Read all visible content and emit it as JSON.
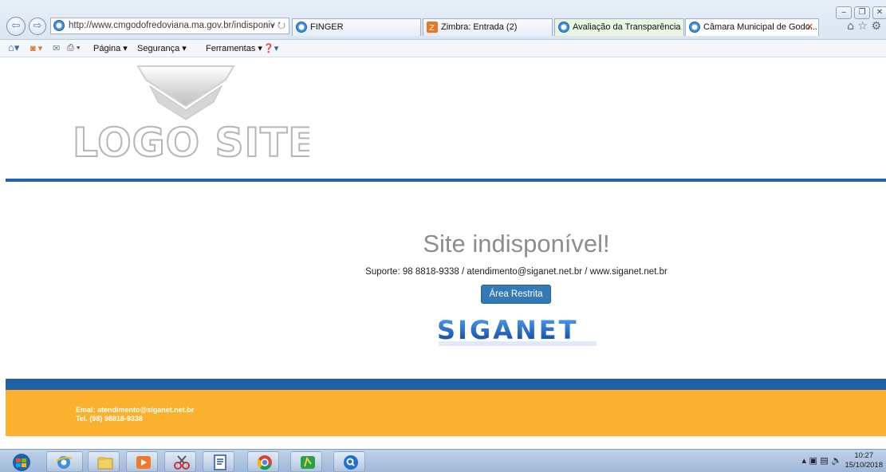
{
  "browser": {
    "address": "http://www.cmgodofredoviana.ma.gov.br/indisponiv",
    "address_actions": "⌕ ▾ ↻",
    "tabs": [
      {
        "label": "FINGER"
      },
      {
        "label": "Zimbra: Entrada (2)"
      },
      {
        "label": "Avaliação da Transparência do..."
      },
      {
        "label": "Câmara Municipal de Godo..."
      }
    ],
    "tab_close": "✕",
    "command_bar": {
      "page": "Página ▾",
      "security": "Segurança ▾",
      "tools": "Ferramentas ▾"
    }
  },
  "page": {
    "logo_text": "LOGO SITE",
    "heading": "Site indisponível!",
    "support": "Suporte: 98 8818-9338 / atendimento@siganet.net.br / www.siganet.net.br",
    "restricted_button": "Área Restrita",
    "brand": "SIGANET",
    "footer_email": "Emal: atendimento@siganet.net.br",
    "footer_tel": "Tel. (98) 98818-9338"
  },
  "taskbar": {
    "time": "10:27",
    "date": "15/10/2018"
  },
  "colors": {
    "accent_blue": "#1e64b2",
    "footer_orange": "#fbb12e",
    "button_blue": "#337ab7"
  }
}
